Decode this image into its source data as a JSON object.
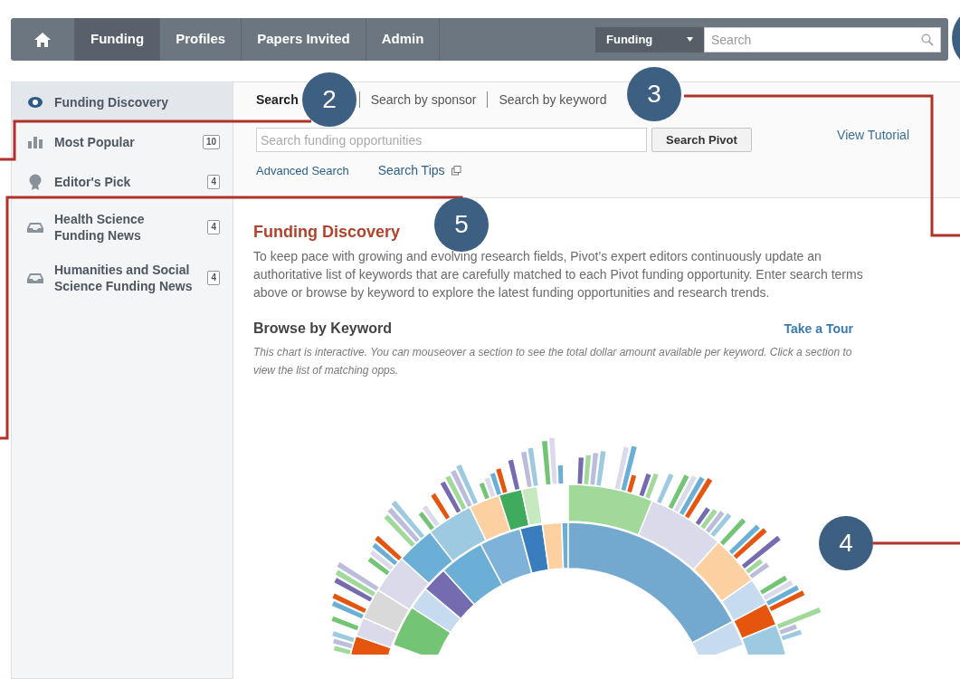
{
  "nav": {
    "items": [
      {
        "label": "Funding",
        "selected": true
      },
      {
        "label": "Profiles",
        "selected": false
      },
      {
        "label": "Papers Invited",
        "selected": false
      },
      {
        "label": "Admin",
        "selected": false
      }
    ],
    "scope_select": {
      "value": "Funding"
    },
    "search": {
      "placeholder": "Search"
    }
  },
  "sidebar": {
    "items": [
      {
        "label": "Funding Discovery",
        "kind": "eye",
        "selected": true
      },
      {
        "label": "Most Popular",
        "kind": "bars",
        "count": "10",
        "selected": false
      },
      {
        "label": "Editor's Pick",
        "kind": "award",
        "count": "4",
        "selected": false
      },
      {
        "label": "Health Science Funding News",
        "kind": "inbox",
        "count": "4",
        "selected": false
      },
      {
        "label": "Humanities and Social Science Funding News",
        "kind": "inbox",
        "count": "4",
        "selected": false
      }
    ]
  },
  "search_tabs": [
    {
      "label": "Search",
      "selected": true
    },
    {
      "label": "Search by sponsor",
      "selected": false
    },
    {
      "label": "Search by keyword",
      "selected": false
    }
  ],
  "search_field": {
    "placeholder": "Search funding opportunities"
  },
  "search_button": "Search Pivot",
  "view_tutorial": "View Tutorial",
  "links": {
    "advanced": "Advanced Search",
    "tips": "Search Tips"
  },
  "heading": "Funding Discovery",
  "description": "To keep pace with growing and evolving research fields, Pivot’s expert editors continuously update an authoritative list of keywords that are carefully matched to each Pivot funding opportunity. Enter search terms above or browse by keyword to explore the latest funding opportunities and research trends.",
  "browse": {
    "title": "Browse by Keyword",
    "tour_link": "Take a Tour",
    "note": "This chart is interactive. You can mouseover a section to see the total dollar amount available per keyword. Click a section to view the list of matching opps."
  },
  "callouts": [
    "2",
    "3",
    "4",
    "5"
  ]
}
